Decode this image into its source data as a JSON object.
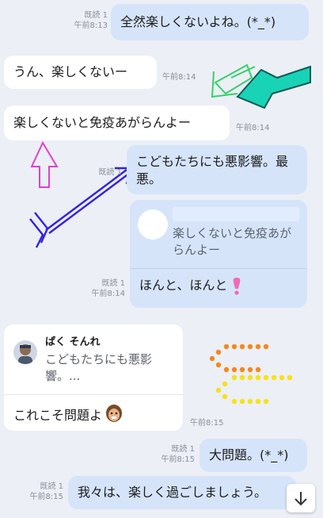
{
  "messages": [
    {
      "read": "既読 1",
      "time": "午前8:13",
      "text": "全然楽しくないよね。(*_*)"
    },
    {
      "time": "午前8:14",
      "text": "うん、楽しくないー"
    },
    {
      "time": "午前8:14",
      "text": "楽しくないと免疫あがらんよー"
    },
    {
      "read": "既読 1",
      "text": "こどもたちにも悪影響。最悪。"
    },
    {
      "read": "既読 1",
      "time": "午前8:14",
      "quote": "楽しくないと免疫あがらんよー",
      "text": "ほんと、ほんと"
    },
    {
      "sender": "ぱく そんれ",
      "quote": "こどもたちにも悪影響。...",
      "time": "午前8:15",
      "text": "これこそ問題よ"
    },
    {
      "read": "既読 1",
      "time": "午前8:15",
      "text": "大問題。(*_*)"
    },
    {
      "read": "既読 1",
      "time": "午前8:15",
      "text": "我々は、楽しく過ごしましょう。"
    }
  ],
  "colors": {
    "bubble_out": "#d6e4fa",
    "bubble_in": "#ffffff",
    "background": "#eceff5"
  },
  "icons": [
    "exclamation-emoji",
    "face-emoji",
    "scroll-down-icon"
  ]
}
